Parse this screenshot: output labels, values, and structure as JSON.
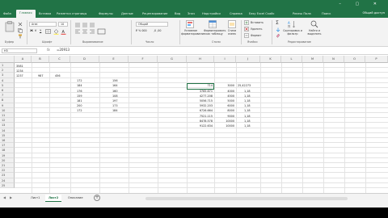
{
  "ribbon_tabs": [
    {
      "label": "Файл"
    },
    {
      "label": "Главная"
    },
    {
      "label": "Вставка"
    },
    {
      "label": "Разметка страницы"
    },
    {
      "label": "Формулы"
    },
    {
      "label": "Данные"
    },
    {
      "label": "Рецензирование"
    },
    {
      "label": "Вид"
    },
    {
      "label": "Знач"
    },
    {
      "label": "Надстройки"
    },
    {
      "label": "Справка"
    },
    {
      "label": "Easy Excel Скайс"
    },
    {
      "label": "Рикеш Пола"
    },
    {
      "label": "Поиск"
    }
  ],
  "share_label": "Общий доступ",
  "ribbon": {
    "font_name": "Arial",
    "font_size": "10",
    "number_format": "Общий",
    "cond_format": "Условное форматирование",
    "format_table": "Форматировать как таблицу",
    "cell_styles": "Стили ячеек",
    "insert": "Вставить",
    "delete": "Удалить",
    "format": "Формат",
    "sort_filter": "Сортировка и фильтр",
    "find_select": "Найти и выделить",
    "groups": {
      "clipboard": "Буфер",
      "font": "Шрифт",
      "alignment": "Выравнивание",
      "number": "Число",
      "styles": "Стили",
      "cells": "Ячейки",
      "editing": "Редактирование"
    }
  },
  "formula_bar": {
    "name_box": "H3",
    "fx": "fx",
    "formula": "=20913"
  },
  "columns": [
    "A",
    "B",
    "C",
    "D",
    "E",
    "F",
    "G",
    "H",
    "I",
    "J",
    "K",
    "L",
    "M",
    "N",
    "O",
    "P"
  ],
  "rows": [
    "1",
    "2",
    "3",
    "4",
    "5",
    "6",
    "7",
    "8",
    "9",
    "10",
    "11",
    "12",
    "13",
    "14",
    "15",
    "16",
    "17",
    "18",
    "19",
    "20",
    "21",
    "22",
    "23",
    "24",
    "25"
  ],
  "cells": {
    "a1": "3581",
    "a2": "1234",
    "a3": "1237",
    "b3": "987",
    "c3": "456",
    "d4": "172",
    "e4": "156",
    "d5": "184",
    "e5": "164",
    "d6": "176",
    "e6": "160",
    "d7": "159",
    "e7": "108",
    "d8": "181",
    "e8": "197",
    "d9": "200",
    "e9": "173",
    "d10": "172",
    "e10": "184",
    "h3": "714",
    "h4": "3765.671",
    "h5": "4277.208",
    "h6": "5056.715",
    "h7": "5932.203",
    "h8": "6726.664",
    "h9": "7521.115",
    "h10": "8478.578",
    "h11": "9122.634",
    "i3": "3000",
    "i4": "4000",
    "i5": "4500",
    "i6": "5000",
    "i7": "6000",
    "i8": "8000",
    "i9": "9000",
    "i10": "10000",
    "i11": "10000",
    "j3": "25,42273",
    "j4": "1,18",
    "j5": "1,18",
    "j6": "1,18",
    "j7": "1,18",
    "j8": "1,18",
    "j9": "1,18",
    "j10": "1,18",
    "j11": "1,18"
  },
  "sheets": [
    {
      "label": "Лист1"
    },
    {
      "label": "Лист2"
    },
    {
      "label": "Описание"
    }
  ]
}
